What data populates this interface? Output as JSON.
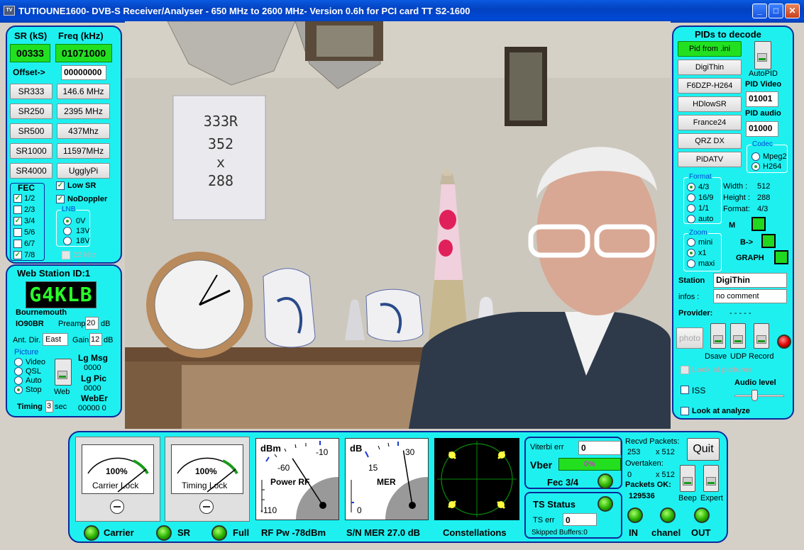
{
  "window": {
    "title": "TUTIOUNE1600- DVB-S Receiver/Analyser - 650 MHz to 2600 MHz- Version 0.6h for PCI card TT S2-1600"
  },
  "left": {
    "sr_header": "SR (kS)",
    "freq_header": "Freq (kHz)",
    "sr_value": "00333",
    "freq_value": "01071000",
    "offset_label": "Offset->",
    "offset_value": "00000000",
    "sr_buttons": [
      "SR333",
      "SR250",
      "SR500",
      "SR1000",
      "SR4000"
    ],
    "freq_buttons": [
      "146.6 MHz",
      "2395 MHz",
      "437Mhz",
      "11597MHz",
      "UgglyPi"
    ],
    "fec_title": "FEC",
    "fec": [
      {
        "label": "1/2",
        "checked": true
      },
      {
        "label": "2/3",
        "checked": false
      },
      {
        "label": "3/4",
        "checked": true
      },
      {
        "label": "5/6",
        "checked": false
      },
      {
        "label": "6/7",
        "checked": false
      },
      {
        "label": "7/8",
        "checked": true
      }
    ],
    "low_sr": "Low SR",
    "nodoppler": "NoDoppler",
    "lnb_title": "LNB",
    "lnb": [
      "0V",
      "13V",
      "18V"
    ],
    "khz": "22 khz"
  },
  "web": {
    "title": "Web Station ID:1",
    "callsign": "G4KLB",
    "city": "Bournemouth",
    "locator": "IO90BR",
    "preamp_label": "Preamp",
    "preamp_value": "20",
    "db1": "dB",
    "antdir_label": "Ant. Dir.",
    "antdir_value": "East",
    "gain_label": "Gain",
    "gain_value": "12",
    "db2": "dB",
    "picture_title": "Picture",
    "picture": [
      "Video",
      "QSL",
      "Auto",
      "Stop"
    ],
    "web_label": "Web",
    "lgmsg_label": "Lg Msg",
    "lgmsg_value": "0000",
    "lgpic_label": "Lg Pic",
    "lgpic_value": "0000",
    "weber_label": "WebEr",
    "weber_value": "00000  0",
    "timing_label": "Timing",
    "timing_value": "3",
    "sec": "sec"
  },
  "video": {
    "sign_lines": [
      "333R",
      "352",
      "x",
      "288"
    ]
  },
  "right": {
    "title": "PIDs to decode",
    "pid_buttons": [
      "Pid from .ini",
      "DigiThin",
      "F6DZP-H264",
      "HDlowSR",
      "France24",
      "QRZ DX",
      "PiDATV"
    ],
    "autopid": "AutoPID",
    "pid_video_label": "PID Video",
    "pid_video_value": "01001",
    "pid_audio_label": "PID audio",
    "pid_audio_value": "01000",
    "codec_title": "Codec",
    "codec": [
      "Mpeg2",
      "H264"
    ],
    "format_title": "Format",
    "format": [
      "4/3",
      "16/9",
      "1/1",
      "auto"
    ],
    "width_label": "Width :",
    "width_value": "512",
    "height_label": "Height :",
    "height_value": "288",
    "fmt_label": "Format:",
    "fmt_value": "4/3",
    "zoom_title": "Zoom",
    "zoom": [
      "mini",
      "x1",
      "maxi"
    ],
    "m_label": "M",
    "b_label": "B->",
    "graph_label": "GRAPH",
    "station_label": "Station",
    "station_value": "DigiThin",
    "infos_label": "infos :",
    "infos_value": "no comment",
    "provider_label": "Provider:",
    "provider_value": "- - - - -",
    "photo": "photo",
    "dsave": "Dsave",
    "udp": "UDP",
    "record": "Record",
    "look_pictures": "Look at pictures",
    "iss": "ISS",
    "audio_level": "Audio level",
    "look_analyze": "Look at analyze"
  },
  "bottom": {
    "carrier_pct": "100%",
    "carrier_lock": "Carrier Lock",
    "timing_pct": "100%",
    "timing_lock": "Timing Lock",
    "rf_unit": "dBm",
    "rf_ticks": [
      "-10",
      "-60",
      "-110"
    ],
    "rf_title": "Power RF",
    "rf_needle_frac": 0.64,
    "mer_unit": "dB",
    "mer_ticks": [
      "30",
      "15",
      "0"
    ],
    "mer_title": "MER",
    "mer_needle_frac": 0.9,
    "carrier_led": "Carrier",
    "sr_led": "SR",
    "full_led": "Full",
    "rf_pw": "RF Pw -78dBm",
    "snmer": "S/N MER  27.0 dB",
    "constellations": "Constellations",
    "viterbi_label": "Viterbi err",
    "viterbi_value": "0",
    "vber_label": "Vber",
    "vber_value": "0%",
    "fec_label": "Fec 3/4",
    "ts_status": "TS Status",
    "ts_err_label": "TS err",
    "ts_err_value": "0",
    "skipped": "Skipped Buffers:0",
    "recvd_label": "Recvd Packets:",
    "recvd_value": "253",
    "recvd_x": "x 512",
    "overtaken_label": "Overtaken:",
    "overtaken_value": "0",
    "overtaken_x": "x 512",
    "packets_ok_label": "Packets OK:",
    "packets_ok_value": "129536",
    "quit": "Quit",
    "beep": "Beep",
    "expert": "Expert",
    "in": "IN",
    "chanel": "chanel",
    "out": "OUT"
  }
}
